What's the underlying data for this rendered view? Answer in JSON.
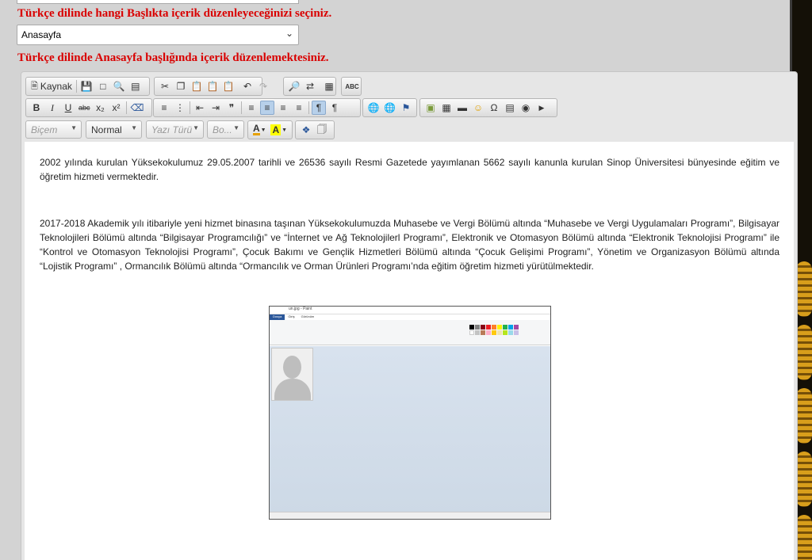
{
  "page": {
    "prompt_select": "Türkçe dilinde hangi Başlıkta içerik düzenleyeceğinizi seçiniz.",
    "prompt_editing": "Türkçe dilinde Anasayfa başlığında içerik düzenlemektesiniz."
  },
  "title_select": {
    "value": "Anasayfa"
  },
  "toolbar": {
    "source": "Kaynak",
    "bold": "B",
    "italic": "I",
    "underline": "U",
    "strike": "abc",
    "subscript": "x₂",
    "superscript": "x²",
    "blockquote": "❞",
    "spell": "ABC",
    "format_combo": "Biçem",
    "style_combo": "Normal",
    "font_combo": "Yazı Türü",
    "size_combo": "Bo...",
    "text_color": "A",
    "bg_color": "A"
  },
  "content": {
    "paragraph1": "2002 yılında kurulan Yüksekokulumuz 29.05.2007 tarihli ve 26536 sayılı Resmi Gazetede yayımlanan 5662 sayılı kanunla kurulan Sinop Üniversitesi bünyesinde eğitim ve öğretim hizmeti vermektedir.",
    "paragraph2": "2017-2018 Akademik yılı itibariyle yeni hizmet binasına taşınan Yüksekokulumuzda Muhasebe ve Vergi Bölümü altında “Muhasebe ve Vergi Uygulamaları Programı”, Bilgisayar Teknolojileri Bölümü altında “Bilgisayar Programcılığı” ve “İnternet ve Ağ Teknolojilerl Programı”, Elektronik ve Otomasyon Bölümü altında “Elektronik Teknolojisi Programı” ile “Kontrol ve Otomasyon Teknolojisi Programı”, Çocuk Bakımı ve Gençlik Hizmetleri Bölümü altında “Çocuk Gelişimi Programı”, Yönetim ve Organizasyon Bölümü altında “Lojistik Programı” , Ormancılık Bölümü altında “Ormancılık ve Orman Ürünleri Programı’nda eğitim öğretim hizmeti yürütülmektedir."
  },
  "embedded_image": {
    "window_title": "un.jpg - Paint",
    "tabs": [
      "Dosya",
      "Giriş",
      "Görünüm"
    ]
  },
  "colors": {
    "prompt": "#d90000",
    "editor_bg": "#e6e6e6",
    "accent": "#2b579a"
  }
}
